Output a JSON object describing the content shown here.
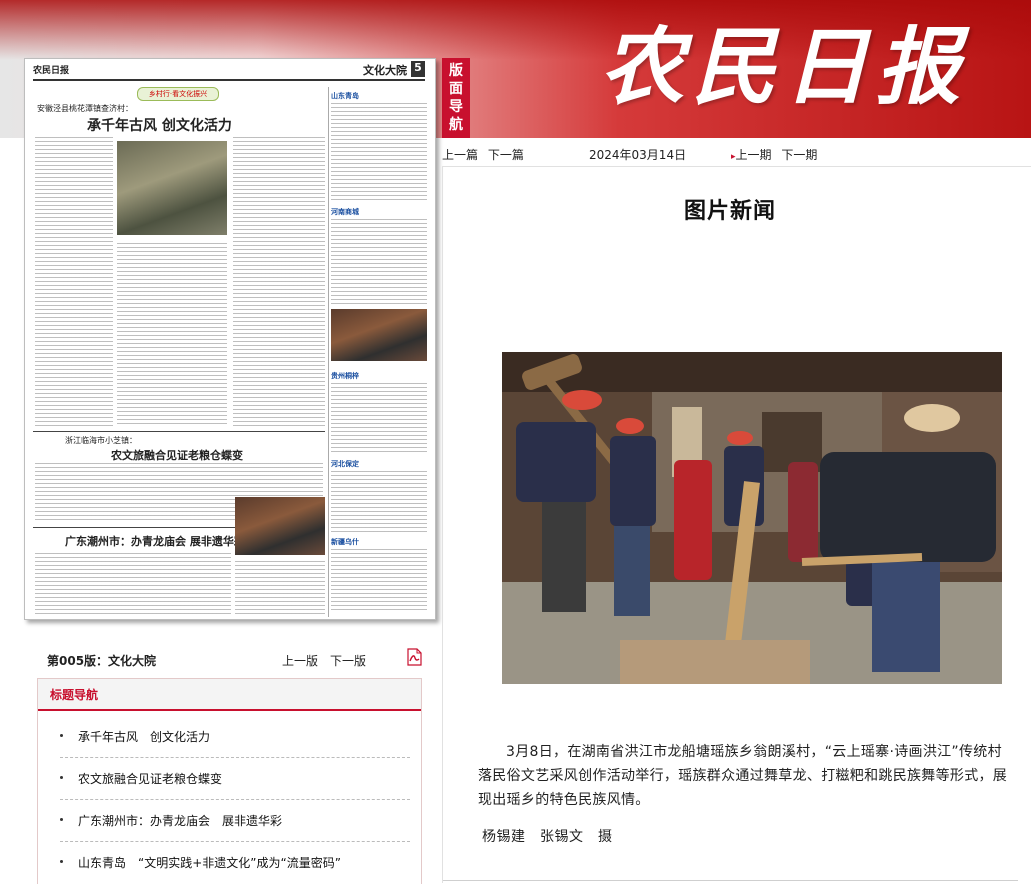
{
  "masthead": {
    "logo_text": "农民日报",
    "section_guide": "版面导航"
  },
  "thumbnail": {
    "masthead": "农民日报",
    "section": "文化大院",
    "page_no": "5",
    "badge": "乡村行·看文化振兴",
    "story1_kicker": "安徽泾县桃花潭镇查济村：",
    "story1_title": "承千年古风  创文化活力",
    "story2_kicker": "浙江临海市小芝镇：",
    "story2_title": "农文旅融合见证老粮仓蝶变",
    "story3_title": "广东潮州市：办青龙庙会  展非遗华彩",
    "side1_title": "山东青岛",
    "side2_title": "河南商城",
    "side3_title": "贵州桐梓",
    "side4_title": "河北保定",
    "side5_title": "新疆乌什"
  },
  "page_nav": {
    "page_label": "第005版：文化大院",
    "prev_page": "上一版",
    "next_page": "下一版",
    "pdf_icon": "pdf-icon"
  },
  "headline_nav": {
    "title": "标题导航",
    "items": [
      "承千年古风　创文化活力",
      "农文旅融合见证老粮仓蝶变",
      "广东潮州市：办青龙庙会　展非遗华彩",
      "山东青岛　“文明实践+非遗文化”成为“流量密码”"
    ]
  },
  "top_nav": {
    "prev_article": "上一篇",
    "next_article": "下一篇",
    "date": "2024年03月14日",
    "prev_issue": "上一期",
    "next_issue": "下一期"
  },
  "article": {
    "title": "图片新闻",
    "body": "3月8日，在湖南省洪江市龙船塘瑶族乡翁朗溪村，“云上瑶寨·诗画洪江”传统村落民俗文艺采风创作活动举行，瑶族群众通过舞草龙、打糍粑和跳民族舞等形式，展现出瑶乡的特色民族风情。",
    "credit": "杨锡建　张锡文　摄"
  },
  "colors": {
    "accent": "#c8102e",
    "banner_dark": "#b81414"
  }
}
